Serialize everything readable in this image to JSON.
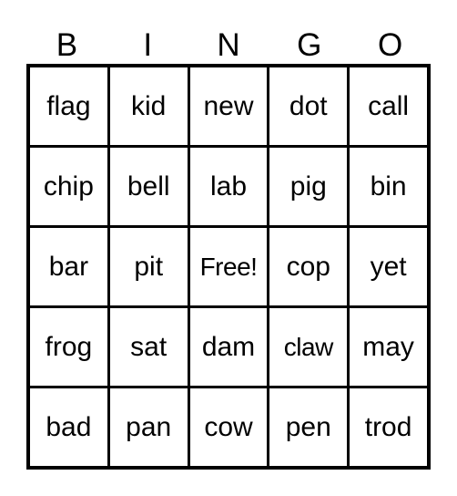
{
  "card": {
    "title": "BINGO",
    "columns": [
      "B",
      "I",
      "N",
      "G",
      "O"
    ],
    "free_space_label": "Free!",
    "free_space_position": {
      "row": 2,
      "col": 2
    },
    "grid_size": "5x5",
    "colors": {
      "background": "#ffffff",
      "border": "#000000",
      "text": "#000000",
      "cell_fill": "#ffffff"
    },
    "rows": [
      {
        "cells": [
          {
            "text": "flag",
            "free": false
          },
          {
            "text": "kid",
            "free": false
          },
          {
            "text": "new",
            "free": false
          },
          {
            "text": "dot",
            "free": false
          },
          {
            "text": "call",
            "free": false
          }
        ]
      },
      {
        "cells": [
          {
            "text": "chip",
            "free": false
          },
          {
            "text": "bell",
            "free": false
          },
          {
            "text": "lab",
            "free": false
          },
          {
            "text": "pig",
            "free": false
          },
          {
            "text": "bin",
            "free": false
          }
        ]
      },
      {
        "cells": [
          {
            "text": "bar",
            "free": false
          },
          {
            "text": "pit",
            "free": false
          },
          {
            "text": "Free!",
            "free": true
          },
          {
            "text": "cop",
            "free": false
          },
          {
            "text": "yet",
            "free": false
          }
        ]
      },
      {
        "cells": [
          {
            "text": "frog",
            "free": false
          },
          {
            "text": "sat",
            "free": false
          },
          {
            "text": "dam",
            "free": false
          },
          {
            "text": "claw",
            "free": false
          },
          {
            "text": "may",
            "free": false
          }
        ]
      },
      {
        "cells": [
          {
            "text": "bad",
            "free": false
          },
          {
            "text": "pan",
            "free": false
          },
          {
            "text": "cow",
            "free": false
          },
          {
            "text": "pen",
            "free": false
          },
          {
            "text": "trod",
            "free": false
          }
        ]
      }
    ]
  }
}
